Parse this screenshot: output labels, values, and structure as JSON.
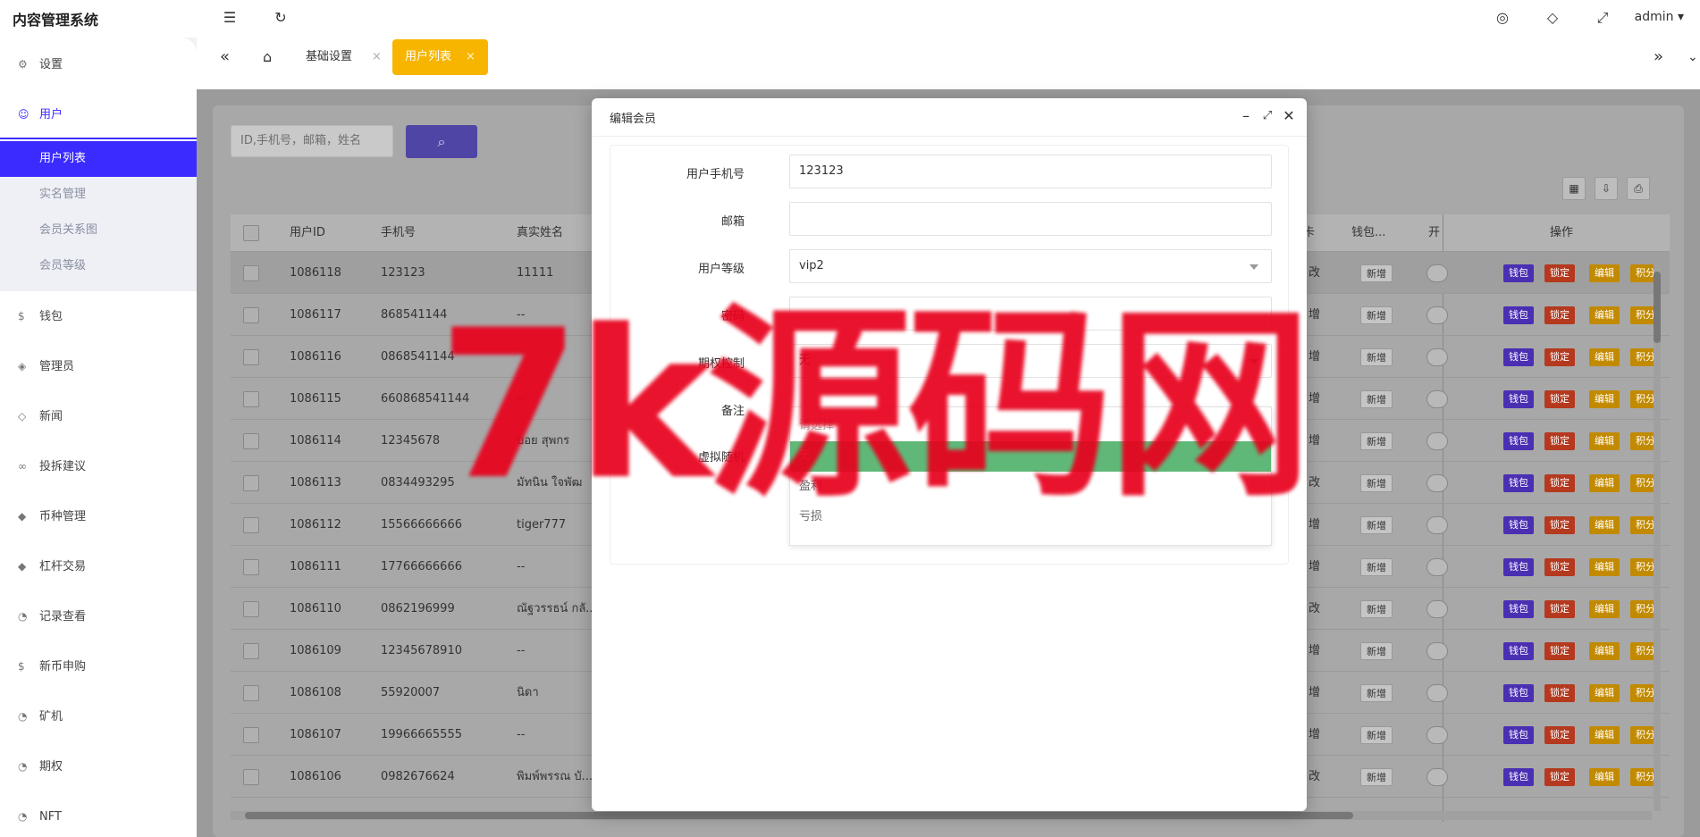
{
  "app": {
    "title": "内容管理系统",
    "user": "admin"
  },
  "sidebar": {
    "items": [
      {
        "label": "设置",
        "icon": "gear-icon"
      },
      {
        "label": "用户",
        "icon": "user-icon"
      },
      {
        "label": "钱包",
        "icon": "coin-icon"
      },
      {
        "label": "管理员",
        "icon": "shield-icon"
      },
      {
        "label": "新闻",
        "icon": "tag-icon"
      },
      {
        "label": "投拆建议",
        "icon": "infinity-icon"
      },
      {
        "label": "币种管理",
        "icon": "diamond-icon"
      },
      {
        "label": "杠杆交易",
        "icon": "diamond-icon"
      },
      {
        "label": "记录查看",
        "icon": "clock-icon"
      },
      {
        "label": "新币申购",
        "icon": "coin-icon"
      },
      {
        "label": "矿机",
        "icon": "clock-icon"
      },
      {
        "label": "期权",
        "icon": "clock-icon"
      },
      {
        "label": "NFT",
        "icon": "clock-icon"
      }
    ],
    "submenu": [
      "用户列表",
      "实名管理",
      "会员关系图",
      "会员等级"
    ]
  },
  "tabs": {
    "basic": "基础设置",
    "userlist": "用户列表"
  },
  "search": {
    "placeholder": "ID,手机号，邮箱，姓名"
  },
  "table": {
    "headers": {
      "id": "用户ID",
      "phone": "手机号",
      "name": "真实姓名",
      "card": "卡",
      "wallet": "钱包...",
      "open": "开",
      "actions": "操作"
    },
    "action_labels": {
      "wallet": "钱包",
      "lock": "锁定",
      "edit": "编辑",
      "points": "积分",
      "add": "新增"
    },
    "rows": [
      {
        "id": "1086118",
        "phone": "123123",
        "name": "11111",
        "card": "改"
      },
      {
        "id": "1086117",
        "phone": "868541144",
        "name": "--",
        "card": "增"
      },
      {
        "id": "1086116",
        "phone": "0868541144",
        "name": "",
        "card": "增"
      },
      {
        "id": "1086115",
        "phone": "660868541144",
        "name": "--",
        "card": "增"
      },
      {
        "id": "1086114",
        "phone": "12345678",
        "name": "บอย สุพกร",
        "card": "增"
      },
      {
        "id": "1086113",
        "phone": "0834493295",
        "name": "มัทนิน ใจพัฒ",
        "card": "改"
      },
      {
        "id": "1086112",
        "phone": "15566666666",
        "name": "tiger777",
        "card": "增"
      },
      {
        "id": "1086111",
        "phone": "17766666666",
        "name": "--",
        "card": "增"
      },
      {
        "id": "1086110",
        "phone": "0862196999",
        "name": "ณัฐวรรธน์ กลั...",
        "card": "改"
      },
      {
        "id": "1086109",
        "phone": "12345678910",
        "name": "--",
        "card": "增"
      },
      {
        "id": "1086108",
        "phone": "55920007",
        "name": "นิดา",
        "card": "增"
      },
      {
        "id": "1086107",
        "phone": "19966665555",
        "name": "--",
        "card": "增"
      },
      {
        "id": "1086106",
        "phone": "0982676624",
        "name": "พิมพ์พรรณ บั...",
        "card": "改"
      }
    ]
  },
  "modal": {
    "title": "编辑会员",
    "fields": {
      "phone_label": "用户手机号",
      "phone_value": "123123",
      "email_label": "邮箱",
      "email_value": "",
      "level_label": "用户等级",
      "level_value": "vip2",
      "pwd_label": "密码",
      "control_label": "期权控制",
      "control_value": "无",
      "note_label": "备注",
      "virtual_label": "虚拟随机"
    },
    "dropdown": [
      "请选择",
      "无",
      "盈利",
      "亏损"
    ]
  },
  "watermark": "7k源码网"
}
